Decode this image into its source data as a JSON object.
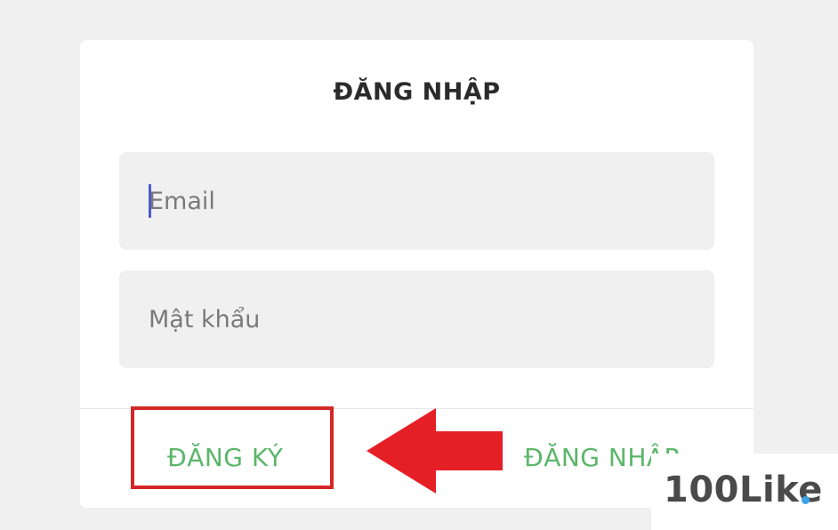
{
  "login_form": {
    "title": "ĐĂNG NHẬP",
    "email_placeholder": "Email",
    "password_placeholder": "Mật khẩu",
    "register_label": "ĐĂNG KÝ",
    "login_label": "ĐĂNG NHẬP"
  },
  "watermark": {
    "text": "100Like"
  },
  "colors": {
    "accent_green": "#5bb66a",
    "highlight_red": "#d42727",
    "arrow_red": "#e51f26",
    "caret_blue": "#4b5bd0",
    "watermark_dot": "#3da3e5"
  },
  "icons": {
    "annotation_arrow": "left-arrow-icon"
  }
}
